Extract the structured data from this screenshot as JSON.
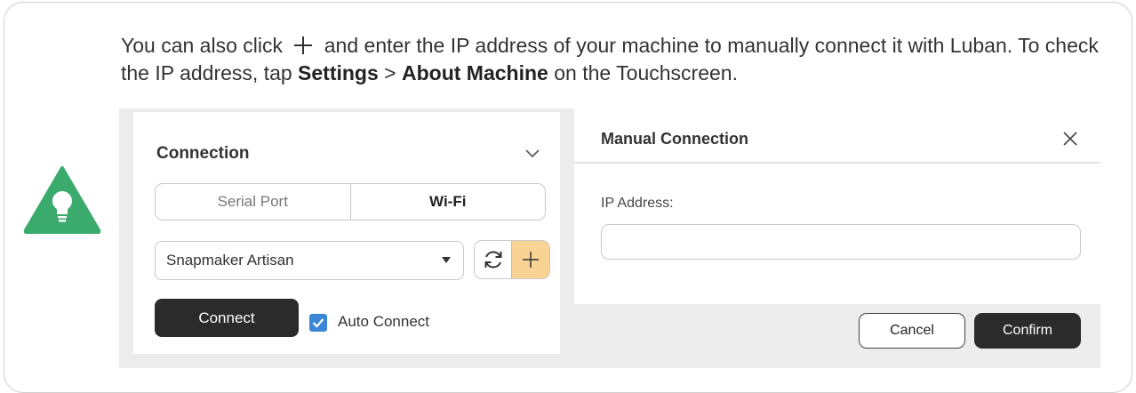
{
  "tip": {
    "part1": "You can also click",
    "part2": "and enter the IP address of your machine to manually connect it with Luban. To check the IP address, tap",
    "settings": "Settings",
    "sep": ">",
    "about": "About Machine",
    "part3": "on the Touchscreen.",
    "icon": "lightbulb-icon",
    "accent": "#3aaa6d"
  },
  "connection": {
    "title": "Connection",
    "tabs": [
      "Serial Port",
      "Wi-Fi"
    ],
    "active_tab": "Wi-Fi",
    "machine_select": "Snapmaker Artisan",
    "connect_label": "Connect",
    "auto_connect_label": "Auto Connect",
    "auto_connect_checked": true,
    "add_highlight": "#f9d394"
  },
  "manual_dialog": {
    "title": "Manual Connection",
    "ip_label": "IP Address:",
    "ip_value": "",
    "cancel_label": "Cancel",
    "confirm_label": "Confirm"
  }
}
